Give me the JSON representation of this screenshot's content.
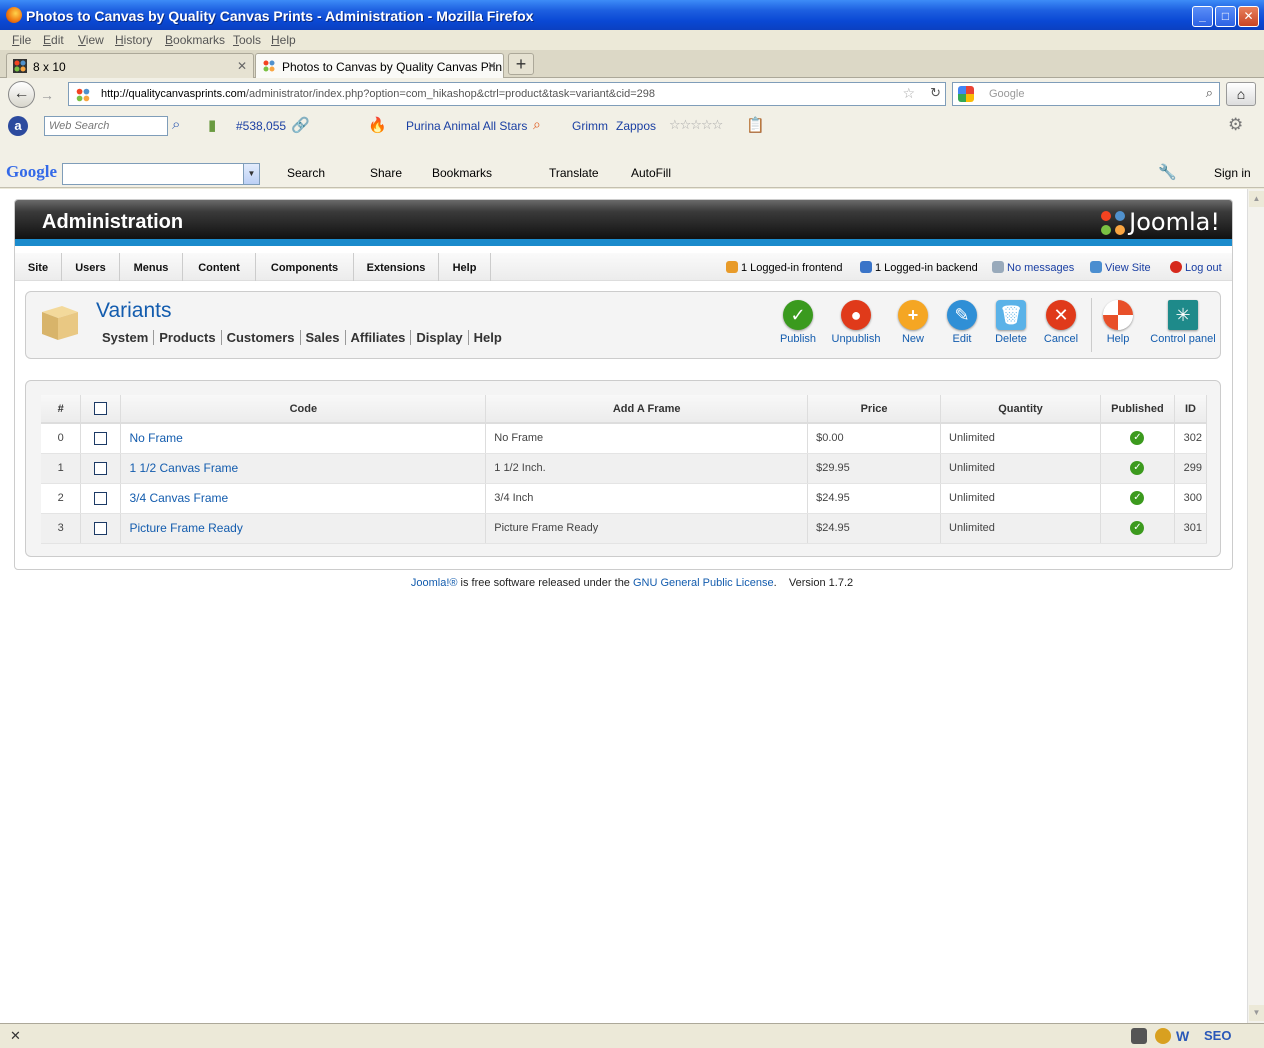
{
  "window": {
    "title": "Photos to Canvas by Quality Canvas Prints - Administration - Mozilla Firefox",
    "minimize": "_",
    "maximize": "□",
    "close": "✕"
  },
  "menubar": [
    "File",
    "Edit",
    "View",
    "History",
    "Bookmarks",
    "Tools",
    "Help"
  ],
  "tabs": [
    {
      "label": "8 x 10",
      "active": false
    },
    {
      "label": "Photos to Canvas by Quality Canvas Prin...",
      "active": true
    }
  ],
  "tab_close": "✕",
  "new_tab": "+",
  "navbar": {
    "url_domain": "http://qualitycanvasprints.com",
    "url_path": "/administrator/index.php?option=com_hikashop&ctrl=product&task=variant&cid=298",
    "search_placeholder": "Google"
  },
  "toolbar1": {
    "websearch_placeholder": "Web Search",
    "rank": "#538,055",
    "link1": "Purina Animal All Stars",
    "link2": "Grimm",
    "link3": "Zappos"
  },
  "toolbar2": {
    "logo": "Google",
    "search": "Search",
    "share": "Share",
    "bookmarks": "Bookmarks",
    "translate": "Translate",
    "autofill": "AutoFill",
    "signin": "Sign in"
  },
  "admin": {
    "header_title": "Administration",
    "logo_text": "Joomla!",
    "menu": [
      "Site",
      "Users",
      "Menus",
      "Content",
      "Components",
      "Extensions",
      "Help"
    ],
    "status": {
      "frontend": "1 Logged-in frontend",
      "backend": "1 Logged-in backend",
      "messages": "No messages",
      "view_site": "View Site",
      "logout": "Log out"
    }
  },
  "panel": {
    "title": "Variants",
    "submenu": [
      "System",
      "Products",
      "Customers",
      "Sales",
      "Affiliates",
      "Display",
      "Help"
    ],
    "buttons": {
      "publish": "Publish",
      "unpublish": "Unpublish",
      "new": "New",
      "edit": "Edit",
      "delete": "Delete",
      "cancel": "Cancel",
      "help": "Help",
      "control_panel": "Control panel"
    }
  },
  "table": {
    "headers": [
      "#",
      "",
      "Code",
      "Add A Frame",
      "Price",
      "Quantity",
      "Published",
      "ID"
    ],
    "rows": [
      {
        "num": "0",
        "code": "No Frame",
        "frame": "No Frame",
        "price": "$0.00",
        "quantity": "Unlimited",
        "published": true,
        "id": "302"
      },
      {
        "num": "1",
        "code": "1 1/2 Canvas Frame",
        "frame": "1 1/2 Inch.",
        "price": "$29.95",
        "quantity": "Unlimited",
        "published": true,
        "id": "299"
      },
      {
        "num": "2",
        "code": "3/4 Canvas Frame",
        "frame": "3/4 Inch",
        "price": "$24.95",
        "quantity": "Unlimited",
        "published": true,
        "id": "300"
      },
      {
        "num": "3",
        "code": "Picture Frame Ready",
        "frame": "Picture Frame Ready",
        "price": "$24.95",
        "quantity": "Unlimited",
        "published": true,
        "id": "301"
      }
    ]
  },
  "footer": {
    "joomla": "Joomla!®",
    "text1": " is free software released under the ",
    "license": "GNU General Public License",
    "text2": ".",
    "version": "Version 1.7.2"
  },
  "statusbar": {
    "close": "✕"
  }
}
